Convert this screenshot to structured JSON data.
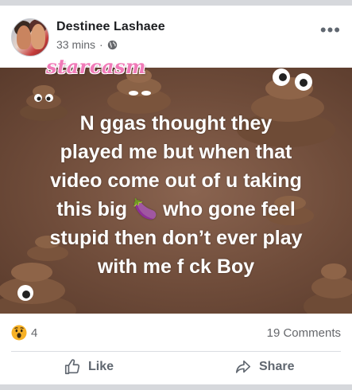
{
  "post": {
    "author": "Destinee Lashaee",
    "time": "33 mins",
    "separator": "·",
    "more_label": "•••",
    "watermark": "starcasm",
    "lines": [
      "N ggas thought they",
      "played me but when that",
      "video come out of u taking",
      "this big 🍆 who gone feel",
      "stupid then don’t ever play",
      "with me f  ck Boy"
    ],
    "reaction_count": "4",
    "comments": "19 Comments",
    "like_label": "Like",
    "share_label": "Share"
  },
  "icons": {
    "globe": "globe-icon",
    "reaction": "wow-reaction-icon",
    "like": "thumbs-up-icon",
    "share": "share-arrow-icon",
    "more": "more-options-icon"
  },
  "colors": {
    "name": "#1c1e21",
    "secondary": "#65676b",
    "image_bg": "#6f4c3a",
    "watermark": "#f07bb8"
  }
}
